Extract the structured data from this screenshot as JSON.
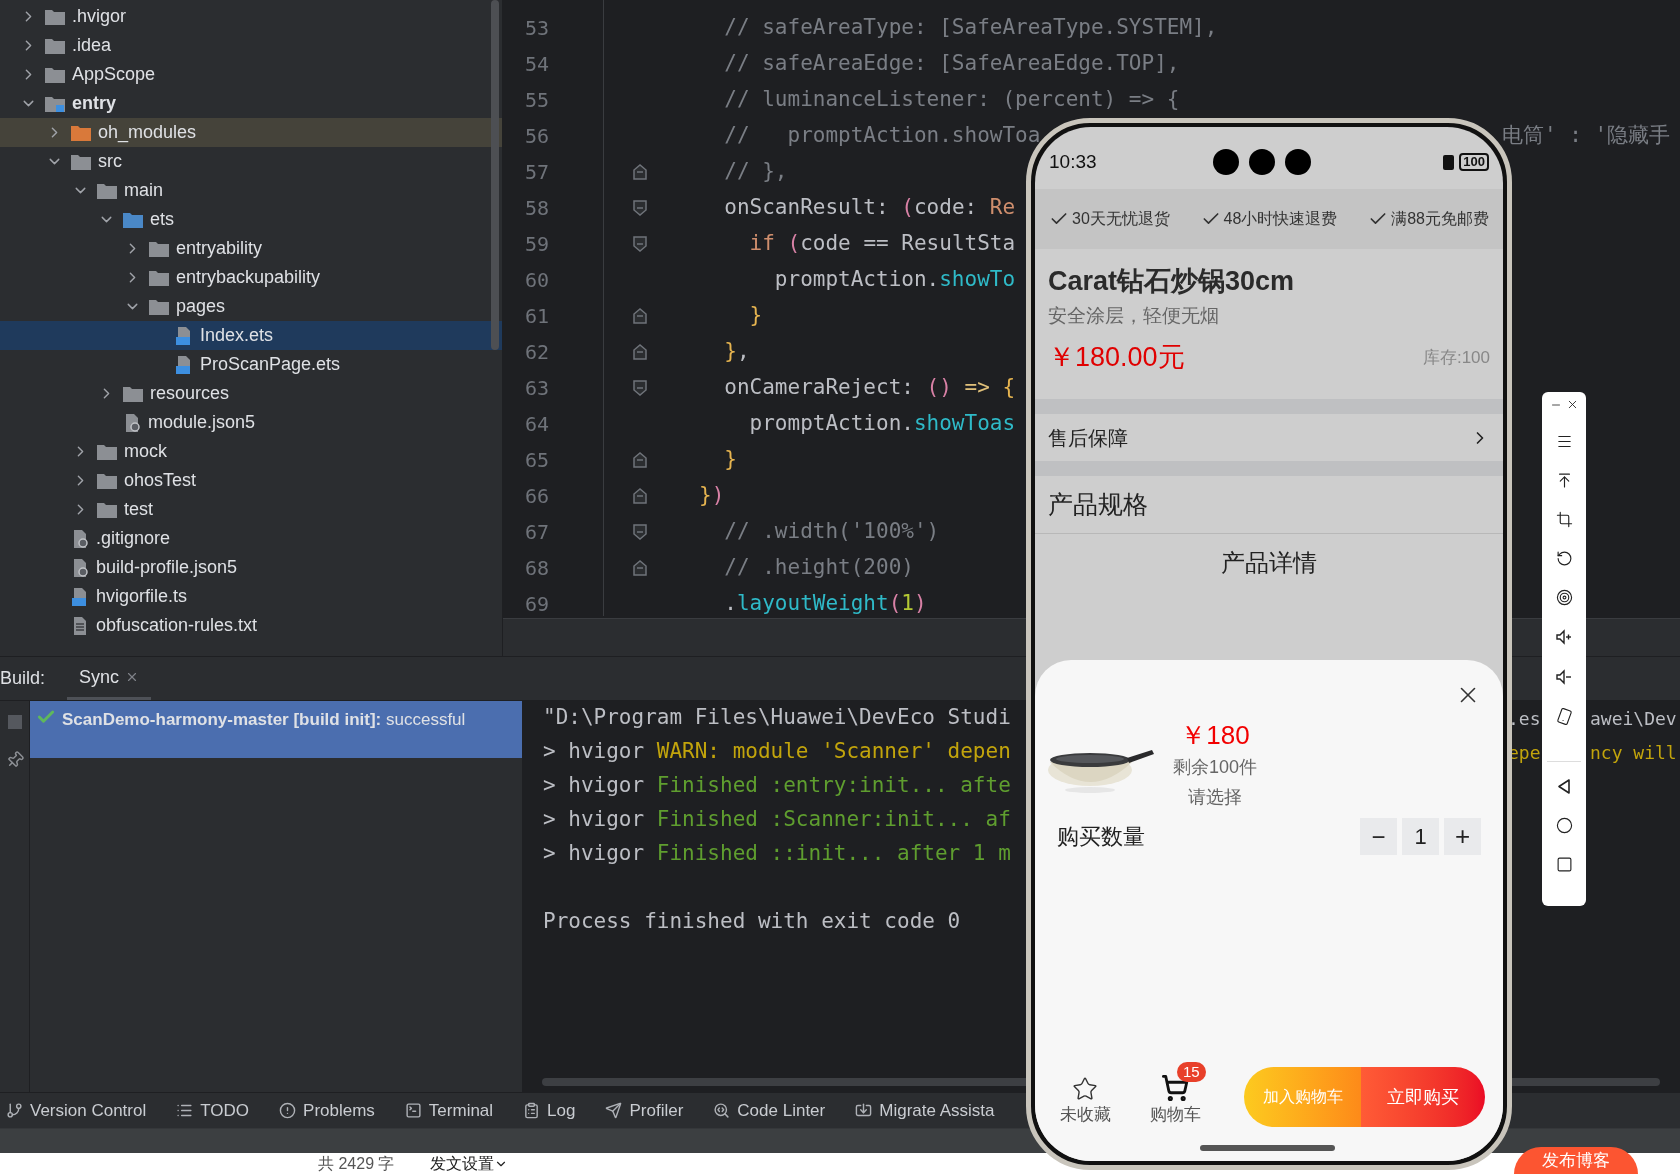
{
  "project_tree": {
    "items": [
      {
        "name": ".hvigor",
        "kind": "folder",
        "expanded": false,
        "selected": false
      },
      {
        "name": ".idea",
        "kind": "folder",
        "expanded": false,
        "selected": false
      },
      {
        "name": "AppScope",
        "kind": "folder",
        "expanded": false,
        "selected": false
      },
      {
        "name": "entry",
        "kind": "module",
        "expanded": true,
        "selected": false,
        "children": [
          {
            "name": "oh_modules",
            "kind": "excluded",
            "expanded": false,
            "selected": false
          },
          {
            "name": "src",
            "kind": "folder",
            "expanded": true,
            "selected": false,
            "children": [
              {
                "name": "main",
                "kind": "folder",
                "expanded": true,
                "selected": false,
                "children": [
                  {
                    "name": "ets",
                    "kind": "source",
                    "expanded": true,
                    "selected": false,
                    "children": [
                      {
                        "name": "entryability",
                        "kind": "folder",
                        "expanded": false,
                        "selected": false
                      },
                      {
                        "name": "entrybackupability",
                        "kind": "folder",
                        "expanded": false,
                        "selected": false
                      },
                      {
                        "name": "pages",
                        "kind": "folder",
                        "expanded": true,
                        "selected": false,
                        "children": [
                          {
                            "name": "Index.ets",
                            "kind": "ets",
                            "selected": true
                          },
                          {
                            "name": "ProScanPage.ets",
                            "kind": "ets",
                            "selected": false
                          }
                        ]
                      }
                    ]
                  },
                  {
                    "name": "resources",
                    "kind": "folder",
                    "expanded": false,
                    "selected": false
                  },
                  {
                    "name": "module.json5",
                    "kind": "json",
                    "selected": false
                  }
                ]
              },
              {
                "name": "mock",
                "kind": "folder",
                "expanded": false,
                "selected": false
              },
              {
                "name": "ohosTest",
                "kind": "folder",
                "expanded": false,
                "selected": false
              },
              {
                "name": "test",
                "kind": "folder",
                "expanded": false,
                "selected": false
              }
            ]
          },
          {
            "name": ".gitignore",
            "kind": "json",
            "selected": false
          },
          {
            "name": "build-profile.json5",
            "kind": "json",
            "selected": false
          },
          {
            "name": "hvigorfile.ts",
            "kind": "ts",
            "selected": false
          },
          {
            "name": "obfuscation-rules.txt",
            "kind": "txt",
            "selected": false
          }
        ]
      }
    ]
  },
  "editor": {
    "lines": [
      {
        "number": "53",
        "tokens": [
          {
            "kind": "comment",
            "text": "  // safeAreaType: [SafeAreaType.SYSTEM],"
          }
        ]
      },
      {
        "number": "54",
        "tokens": [
          {
            "kind": "comment",
            "text": "  // safeAreaEdge: [SafeAreaEdge.TOP],"
          }
        ]
      },
      {
        "number": "55",
        "tokens": [
          {
            "kind": "comment",
            "text": "  // luminanceListener: (percent) => {"
          }
        ]
      },
      {
        "number": "56",
        "tokens": [
          {
            "kind": "comment",
            "text": "  //   promptAction.showToa"
          }
        ],
        "tail": {
          "kind": "comment",
          "text": "电筒' : '隐藏手"
        }
      },
      {
        "number": "57",
        "kind": "fold_end",
        "tokens": [
          {
            "kind": "comment",
            "text": "  // },"
          }
        ]
      },
      {
        "number": "58",
        "kind": "fold_start",
        "tokens": [
          {
            "kind": "plain",
            "text": "  onScanResult: "
          },
          {
            "kind": "paren",
            "text": "("
          },
          {
            "kind": "plain",
            "text": "code: "
          },
          {
            "kind": "type",
            "text": "Re"
          }
        ]
      },
      {
        "number": "59",
        "kind": "fold_start",
        "tokens": [
          {
            "kind": "keyword",
            "text": "    if "
          },
          {
            "kind": "paren",
            "text": "("
          },
          {
            "kind": "plain",
            "text": "code == ResultSta"
          }
        ]
      },
      {
        "number": "60",
        "tokens": [
          {
            "kind": "plain",
            "text": "      promptAction."
          },
          {
            "kind": "method",
            "text": "showTo"
          }
        ]
      },
      {
        "number": "61",
        "kind": "fold_end",
        "tokens": [
          {
            "kind": "brace",
            "text": "    }"
          }
        ]
      },
      {
        "number": "62",
        "kind": "fold_end",
        "tokens": [
          {
            "kind": "brace",
            "text": "  }"
          },
          {
            "kind": "plain",
            "text": ","
          }
        ]
      },
      {
        "number": "63",
        "kind": "fold_start",
        "tokens": [
          {
            "kind": "plain",
            "text": "  onCameraReject: "
          },
          {
            "kind": "paren",
            "text": "()"
          },
          {
            "kind": "operator",
            "text": " => "
          },
          {
            "kind": "brace",
            "text": "{"
          }
        ]
      },
      {
        "number": "64",
        "tokens": [
          {
            "kind": "plain",
            "text": "    promptAction."
          },
          {
            "kind": "method",
            "text": "showToas"
          }
        ]
      },
      {
        "number": "65",
        "kind": "fold_end",
        "tokens": [
          {
            "kind": "brace",
            "text": "  }"
          }
        ]
      },
      {
        "number": "66",
        "kind": "fold_end",
        "tokens": [
          {
            "kind": "brace",
            "text": "}"
          },
          {
            "kind": "paren",
            "text": ")"
          }
        ]
      },
      {
        "number": "67",
        "kind": "fold_start",
        "tokens": [
          {
            "kind": "comment",
            "text": "  // .width('100%')"
          }
        ]
      },
      {
        "number": "68",
        "kind": "fold_end",
        "tokens": [
          {
            "kind": "comment",
            "text": "  // .height(200)"
          }
        ]
      },
      {
        "number": "69",
        "tokens": [
          {
            "kind": "plain",
            "text": "  ."
          },
          {
            "kind": "method",
            "text": "layoutWeight"
          },
          {
            "kind": "paren",
            "text": "("
          },
          {
            "kind": "number",
            "text": "1"
          },
          {
            "kind": "paren",
            "text": ")"
          }
        ]
      }
    ]
  },
  "build_panel": {
    "title": "Build:",
    "tabs": [
      {
        "label": "Sync",
        "selected": true
      }
    ],
    "task": {
      "text": "**ScanDemo-harmony-master [build init]:** successful",
      "kind": "success",
      "selected": true
    },
    "output": [
      {
        "tokens": [
          {
            "kind": "plain",
            "text": "\"D:\\Program Files\\Huawei\\DevEco Studi"
          }
        ],
        "tails": [
          {
            "kind": "plain",
            "text": ".es"
          },
          {
            "kind": "plain",
            "text": "awei\\Dev"
          }
        ]
      },
      {
        "tokens": [
          {
            "kind": "plain",
            "text": "> hvigor "
          },
          {
            "kind": "warn",
            "text": "WARN: module 'Scanner' depen"
          }
        ],
        "tails": [
          {
            "kind": "warn",
            "text": "epe"
          },
          {
            "kind": "warn",
            "text": "ncy will"
          }
        ]
      },
      {
        "tokens": [
          {
            "kind": "plain",
            "text": "> hvigor "
          },
          {
            "kind": "success",
            "text": "Finished :entry:init... afte"
          }
        ]
      },
      {
        "tokens": [
          {
            "kind": "plain",
            "text": "> hvigor "
          },
          {
            "kind": "success",
            "text": "Finished :Scanner:init... af"
          }
        ]
      },
      {
        "tokens": [
          {
            "kind": "plain",
            "text": "> hvigor "
          },
          {
            "kind": "success",
            "text": "Finished ::init... after 1 m"
          }
        ]
      },
      {
        "kind": "result",
        "tokens": [
          {
            "kind": "plain",
            "text": "Process finished with exit code 0"
          }
        ]
      }
    ]
  },
  "tool_windows": [
    {
      "label": "Version Control",
      "kind": "vcs"
    },
    {
      "label": "TODO",
      "kind": "todo"
    },
    {
      "label": "Problems",
      "kind": "problems"
    },
    {
      "label": "Terminal",
      "kind": "terminal"
    },
    {
      "label": "Log",
      "kind": "log"
    },
    {
      "label": "Profiler",
      "kind": "profiler"
    },
    {
      "label": "Code Linter",
      "kind": "linter"
    },
    {
      "label": "Migrate Assista",
      "kind": "migrate"
    }
  ],
  "web_footer": {
    "word_count": "共 2429 字",
    "settings": "发文设置",
    "publish": "发布博客"
  },
  "phone": {
    "status_bar": {
      "time": "10:33",
      "battery": "100"
    },
    "guarantees": [
      "30天无忧退货",
      "48小时快速退费",
      "满88元免邮费"
    ],
    "product": {
      "title": "Carat钻石炒锅30cm",
      "subtitle": "安全涂层，轻便无烟",
      "price": "￥180.00元",
      "stock": "库存:100"
    },
    "after_sales": "售后保障",
    "specs": "产品规格",
    "details": "产品详情",
    "sheet": {
      "price": "￥180",
      "remaining": "剩余100件",
      "prompt": "请选择",
      "quantity_label": "购买数量",
      "minus": "−",
      "quantity": "1",
      "plus": "+",
      "favorite": {
        "label": "未收藏",
        "on": false
      },
      "cart": {
        "label": "购物车",
        "badge": "15"
      },
      "add_to_cart": "加入购物车",
      "buy_now": "立即购买"
    }
  }
}
